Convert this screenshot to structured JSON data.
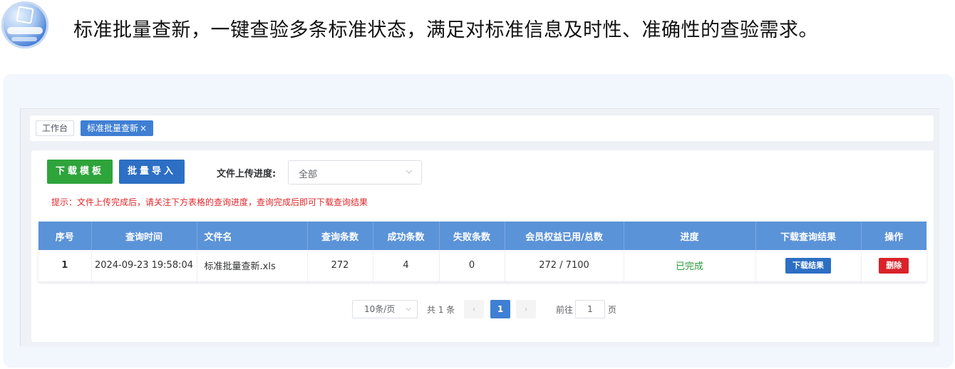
{
  "hero": {
    "text": "标准批量查新，一键查验多条标准状态，满足对标准信息及时性、准确性的查验需求。"
  },
  "tags": {
    "home": "工作台",
    "active": "标准批量查新",
    "close": "×"
  },
  "toolbar": {
    "download_template": "下载模板",
    "batch_import": "批量导入",
    "progress_label": "文件上传进度:",
    "progress_select_value": "全部"
  },
  "hint": "提示：文件上传完成后，请关注下方表格的查询进度，查询完成后即可下载查询结果",
  "table": {
    "headers": [
      "序号",
      "查询时间",
      "文件名",
      "查询条数",
      "成功条数",
      "失败条数",
      "会员权益已用/总数",
      "进度",
      "下载查询结果",
      "操作"
    ],
    "rows": [
      {
        "index": "1",
        "time": "2024-09-23 19:58:04",
        "filename": "标准批量查新.xls",
        "query_count": "272",
        "success_count": "4",
        "fail_count": "0",
        "quota": "272 / 7100",
        "status": "已完成",
        "download_label": "下载结果",
        "delete_label": "删除"
      }
    ]
  },
  "pagination": {
    "page_size": "10条/页",
    "total": "共 1 条",
    "prev": "‹",
    "current_page": "1",
    "next": "›",
    "goto_prefix": "前往",
    "goto_value": "1",
    "goto_suffix": "页"
  },
  "colors": {
    "accent_blue": "#3f7fd3",
    "header_blue": "#5b93d8",
    "download_green": "#2ea43b",
    "delete_red": "#d9232a",
    "hint_red": "#e0282b",
    "status_green": "#2a9a38"
  }
}
